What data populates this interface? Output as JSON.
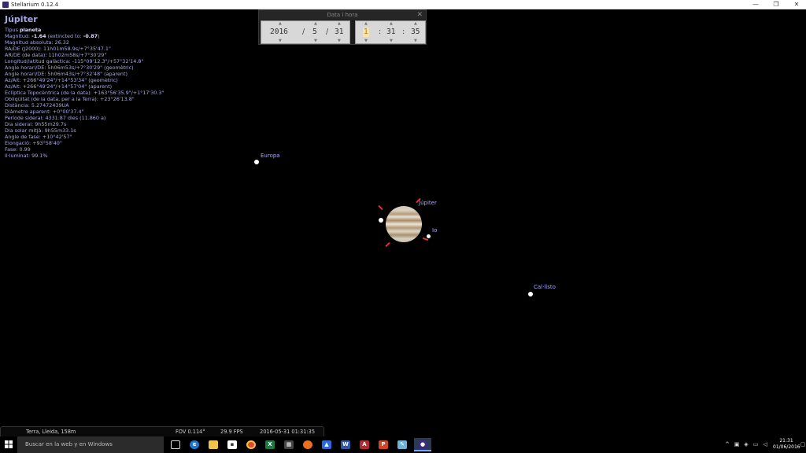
{
  "window": {
    "title": "Stellarium 0.12.4",
    "min_glyph": "—",
    "max_glyph": "❐",
    "close_glyph": "✕"
  },
  "info": {
    "name": "Júpiter",
    "type_label": "Tipus",
    "type_value": "planeta",
    "lines": [
      "RA/DE (J2000): 11h01m58.9s/+7°35'47.1\"",
      "AR/DE (de data): 11h02m58s/+7°30'29\"",
      "Longitud/latitud galàctica: -115°09'12.3\"/+57°32'14.8\"",
      "Angle horari/DE: 5h06m53s/+7°30'29\" (geomètric)",
      "Angle horari/DE: 5h06m43s/+7°32'48\" (aparent)",
      "Az/Alt: +266°49'24\"/+14°53'34\" (geomètric)",
      "Az/Alt: +266°49'24\"/+14°57'04\" (aparent)",
      "Eclíptica Topocèntrica (de la data): +163°56'35.9\"/+1°17'30.3\"",
      "Obliqüitat (de la data, per a la Terra): +23°26'13.8\"",
      "Distància: 5.27472439UA",
      "Diàmetre aparent: +0°00'37.4\"",
      "Període sideral: 4331.87 dies (11.860 a)",
      "Dia sideral: 9h55m29.7s",
      "Dia solar mitjà: 9h55m33.1s",
      "Angle de fase: +10°42'57\"",
      "Elongació: +93°58'40\"",
      "Fase: 0.99",
      "Il·luminat: 99.1%"
    ],
    "magnitude_label": "Magnitud:",
    "magnitude_value": "-1.64",
    "extinction_prefix": "(extincted to:",
    "extinction_value": "-0.87",
    "extinction_suffix": ")",
    "abs_magnitude": "Magnitud absoluta: 26.32"
  },
  "datetime": {
    "title": "Data i hora",
    "close_glyph": "✕",
    "year": "2016",
    "month": "5",
    "day": "31",
    "hour": "1",
    "minute": "31",
    "second": "35",
    "date_sep": "/",
    "time_sep": ":"
  },
  "sky": {
    "labels": {
      "europa": "Europa",
      "jupiter": "Júpiter",
      "io": "Io",
      "callisto": "Cal·listo"
    }
  },
  "statusbar": {
    "location": "Terra, Lleida, 158m",
    "fov": "FOV 0.114°",
    "fps": "29.9 FPS",
    "datetime": "2016-05-31   01:31:35"
  },
  "taskbar": {
    "search_placeholder": "Buscar en la web y en Windows",
    "clock_time": "21:31",
    "clock_date": "01/06/2016"
  }
}
